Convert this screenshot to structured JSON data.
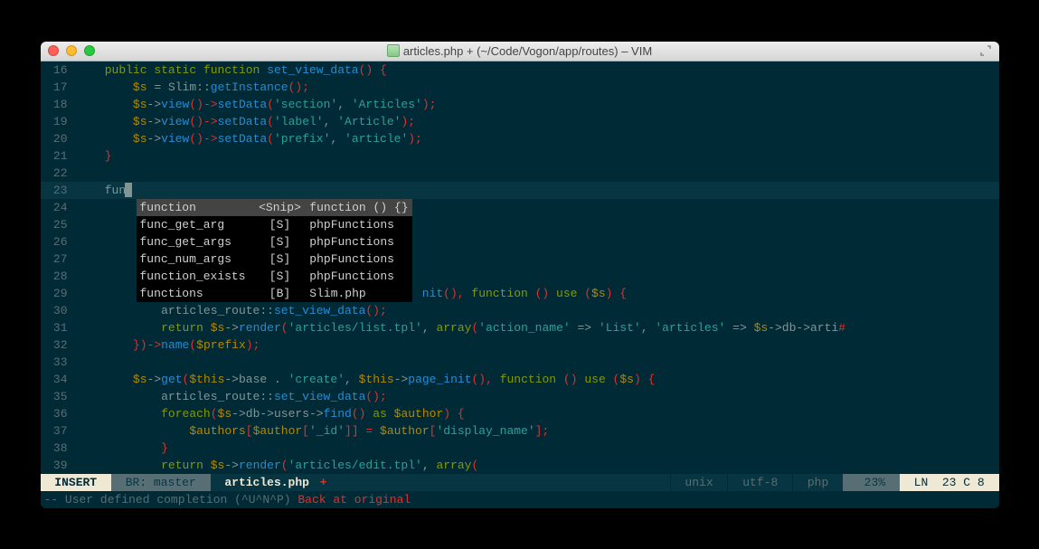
{
  "window": {
    "title": "articles.php + (~/Code/Vogon/app/routes) – VIM"
  },
  "completion": {
    "items": [
      {
        "word": "function",
        "kind": "<Snip>",
        "menu": "function () {}"
      },
      {
        "word": "func_get_arg",
        "kind": "[S]",
        "menu": "phpFunctions"
      },
      {
        "word": "func_get_args",
        "kind": "[S]",
        "menu": "phpFunctions"
      },
      {
        "word": "func_num_args",
        "kind": "[S]",
        "menu": "phpFunctions"
      },
      {
        "word": "function_exists",
        "kind": "[S]",
        "menu": "phpFunctions"
      },
      {
        "word": "functions",
        "kind": "[B]",
        "menu": "Slim.php"
      }
    ]
  },
  "typed": "fun",
  "lines": [
    {
      "n": 16,
      "tokens": [
        [
          "    ",
          ""
        ],
        [
          "public static",
          "kw"
        ],
        [
          " ",
          ""
        ],
        [
          "function",
          "kw"
        ],
        [
          " ",
          ""
        ],
        [
          "set_view_data",
          "fn"
        ],
        [
          "() {",
          "punct"
        ]
      ]
    },
    {
      "n": 17,
      "tokens": [
        [
          "        ",
          ""
        ],
        [
          "$s",
          "var"
        ],
        [
          " = ",
          ""
        ],
        [
          "Slim",
          "ident"
        ],
        [
          "::",
          "op"
        ],
        [
          "getInstance",
          "fn"
        ],
        [
          "();",
          "punct"
        ]
      ]
    },
    {
      "n": 18,
      "tokens": [
        [
          "        ",
          ""
        ],
        [
          "$s",
          "var"
        ],
        [
          "->",
          "op"
        ],
        [
          "view",
          "fn"
        ],
        [
          "()->",
          "punct"
        ],
        [
          "setData",
          "fn"
        ],
        [
          "(",
          "punct"
        ],
        [
          "'section'",
          "str"
        ],
        [
          ", ",
          "op"
        ],
        [
          "'Articles'",
          "str"
        ],
        [
          ");",
          "punct"
        ]
      ]
    },
    {
      "n": 19,
      "tokens": [
        [
          "        ",
          ""
        ],
        [
          "$s",
          "var"
        ],
        [
          "->",
          "op"
        ],
        [
          "view",
          "fn"
        ],
        [
          "()->",
          "punct"
        ],
        [
          "setData",
          "fn"
        ],
        [
          "(",
          "punct"
        ],
        [
          "'label'",
          "str"
        ],
        [
          ", ",
          "op"
        ],
        [
          "'Article'",
          "str"
        ],
        [
          ");",
          "punct"
        ]
      ]
    },
    {
      "n": 20,
      "tokens": [
        [
          "        ",
          ""
        ],
        [
          "$s",
          "var"
        ],
        [
          "->",
          "op"
        ],
        [
          "view",
          "fn"
        ],
        [
          "()->",
          "punct"
        ],
        [
          "setData",
          "fn"
        ],
        [
          "(",
          "punct"
        ],
        [
          "'prefix'",
          "str"
        ],
        [
          ", ",
          "op"
        ],
        [
          "'article'",
          "str"
        ],
        [
          ");",
          "punct"
        ]
      ]
    },
    {
      "n": 21,
      "tokens": [
        [
          "    ",
          ""
        ],
        [
          "}",
          "punct"
        ]
      ]
    },
    {
      "n": 22,
      "tokens": [
        [
          "",
          ""
        ]
      ]
    },
    {
      "n": 23,
      "current": true,
      "tokens": [
        [
          "    ",
          ""
        ],
        [
          "fun",
          "ident"
        ]
      ],
      "cursor": true
    },
    {
      "n": 24,
      "tokens": [
        [
          "",
          ""
        ]
      ]
    },
    {
      "n": 25,
      "tokens": [
        [
          "",
          ""
        ]
      ]
    },
    {
      "n": 26,
      "tokens": [
        [
          "",
          ""
        ]
      ]
    },
    {
      "n": 27,
      "tokens": [
        [
          "",
          ""
        ]
      ]
    },
    {
      "n": 28,
      "tokens": [
        [
          "",
          ""
        ]
      ]
    },
    {
      "n": 29,
      "tokens": [
        [
          "                                                 ",
          ""
        ],
        [
          "nit",
          "fn"
        ],
        [
          "(), ",
          "punct"
        ],
        [
          "function",
          "kw"
        ],
        [
          " () ",
          "punct"
        ],
        [
          "use",
          "kw"
        ],
        [
          " (",
          "punct"
        ],
        [
          "$s",
          "var"
        ],
        [
          ") {",
          "punct"
        ]
      ]
    },
    {
      "n": 30,
      "tokens": [
        [
          "            ",
          ""
        ],
        [
          "articles_route",
          "ident"
        ],
        [
          "::",
          "op"
        ],
        [
          "set_view_data",
          "fn"
        ],
        [
          "();",
          "punct"
        ]
      ]
    },
    {
      "n": 31,
      "tokens": [
        [
          "            ",
          ""
        ],
        [
          "return",
          "kw"
        ],
        [
          " ",
          ""
        ],
        [
          "$s",
          "var"
        ],
        [
          "->",
          "op"
        ],
        [
          "render",
          "fn"
        ],
        [
          "(",
          "punct"
        ],
        [
          "'articles/list.tpl'",
          "str"
        ],
        [
          ", ",
          "op"
        ],
        [
          "array",
          "kw"
        ],
        [
          "(",
          "punct"
        ],
        [
          "'action_name'",
          "str"
        ],
        [
          " => ",
          "op"
        ],
        [
          "'List'",
          "str"
        ],
        [
          ", ",
          "op"
        ],
        [
          "'articles'",
          "str"
        ],
        [
          " => ",
          "op"
        ],
        [
          "$s",
          "var"
        ],
        [
          "->",
          "op"
        ],
        [
          "db",
          "ident"
        ],
        [
          "->",
          "op"
        ],
        [
          "arti",
          "ident"
        ],
        [
          "#",
          "punct"
        ]
      ]
    },
    {
      "n": 32,
      "tokens": [
        [
          "        ",
          ""
        ],
        [
          "})->",
          "punct"
        ],
        [
          "name",
          "fn"
        ],
        [
          "(",
          "punct"
        ],
        [
          "$prefix",
          "var"
        ],
        [
          ");",
          "punct"
        ]
      ]
    },
    {
      "n": 33,
      "tokens": [
        [
          "",
          ""
        ]
      ]
    },
    {
      "n": 34,
      "tokens": [
        [
          "        ",
          ""
        ],
        [
          "$s",
          "var"
        ],
        [
          "->",
          "op"
        ],
        [
          "get",
          "fn"
        ],
        [
          "(",
          "punct"
        ],
        [
          "$this",
          "var"
        ],
        [
          "->",
          "op"
        ],
        [
          "base",
          "ident"
        ],
        [
          " . ",
          "op"
        ],
        [
          "'create'",
          "str"
        ],
        [
          ", ",
          "op"
        ],
        [
          "$this",
          "var"
        ],
        [
          "->",
          "op"
        ],
        [
          "page_init",
          "fn"
        ],
        [
          "(), ",
          "punct"
        ],
        [
          "function",
          "kw"
        ],
        [
          " () ",
          "punct"
        ],
        [
          "use",
          "kw"
        ],
        [
          " (",
          "punct"
        ],
        [
          "$s",
          "var"
        ],
        [
          ") {",
          "punct"
        ]
      ]
    },
    {
      "n": 35,
      "tokens": [
        [
          "            ",
          ""
        ],
        [
          "articles_route",
          "ident"
        ],
        [
          "::",
          "op"
        ],
        [
          "set_view_data",
          "fn"
        ],
        [
          "();",
          "punct"
        ]
      ]
    },
    {
      "n": 36,
      "tokens": [
        [
          "            ",
          ""
        ],
        [
          "foreach",
          "kw"
        ],
        [
          "(",
          "punct"
        ],
        [
          "$s",
          "var"
        ],
        [
          "->",
          "op"
        ],
        [
          "db",
          "ident"
        ],
        [
          "->",
          "op"
        ],
        [
          "users",
          "ident"
        ],
        [
          "->",
          "op"
        ],
        [
          "find",
          "fn"
        ],
        [
          "() ",
          "punct"
        ],
        [
          "as",
          "kw"
        ],
        [
          " ",
          ""
        ],
        [
          "$author",
          "var"
        ],
        [
          ") {",
          "punct"
        ]
      ]
    },
    {
      "n": 37,
      "tokens": [
        [
          "                ",
          ""
        ],
        [
          "$authors",
          "var"
        ],
        [
          "[",
          "punct"
        ],
        [
          "$author",
          "var"
        ],
        [
          "[",
          "punct"
        ],
        [
          "'_id'",
          "str"
        ],
        [
          "]] = ",
          "punct"
        ],
        [
          "$author",
          "var"
        ],
        [
          "[",
          "punct"
        ],
        [
          "'display_name'",
          "str"
        ],
        [
          "];",
          "punct"
        ]
      ]
    },
    {
      "n": 38,
      "tokens": [
        [
          "            ",
          ""
        ],
        [
          "}",
          "punct"
        ]
      ]
    },
    {
      "n": 39,
      "tokens": [
        [
          "            ",
          ""
        ],
        [
          "return",
          "kw"
        ],
        [
          " ",
          ""
        ],
        [
          "$s",
          "var"
        ],
        [
          "->",
          "op"
        ],
        [
          "render",
          "fn"
        ],
        [
          "(",
          "punct"
        ],
        [
          "'articles/edit.tpl'",
          "str"
        ],
        [
          ", ",
          "op"
        ],
        [
          "array",
          "kw"
        ],
        [
          "(",
          "punct"
        ]
      ]
    }
  ],
  "statusline": {
    "mode": " INSERT ",
    "branch": " BR: master ",
    "file": " articles.php",
    "modified": " +",
    "format": " unix ",
    "encoding": " utf-8 ",
    "filetype": " php ",
    "percent": "  23% ",
    "position": " LN  23 C 8 "
  },
  "cmdline": {
    "prefix": "-- User defined completion (^U^N^P) ",
    "msg": "Back at original"
  }
}
